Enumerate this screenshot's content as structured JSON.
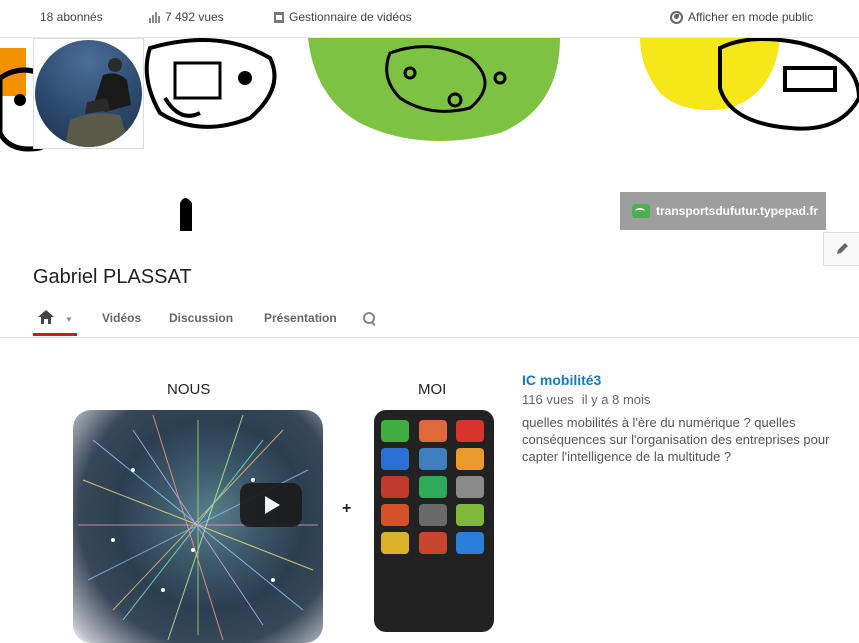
{
  "topbar": {
    "subscribers": "18 abonnés",
    "views": "7 492 vues",
    "video_manager": "Gestionnaire de vidéos",
    "public_view": "Afficher en mode public"
  },
  "banner": {
    "website_link": "transportsdufutur.typepad.fr"
  },
  "channel": {
    "title": "Gabriel PLASSAT"
  },
  "tabs": [
    {
      "label": "Vidéos"
    },
    {
      "label": "Discussion"
    },
    {
      "label": "Présentation"
    }
  ],
  "featured": {
    "thumb_left_label": "NOUS",
    "thumb_right_label": "MOI",
    "plus": "+",
    "title": "IC mobilité3",
    "views": "116 vues",
    "age": "il y a 8 mois",
    "description": "quelles mobilités à l'ère du numérique ? quelles conséquences sur l'organisation des entreprises pour capter l'intelligence de la multitude ?"
  },
  "colors": {
    "accent_red": "#cc181e",
    "link_blue": "#167ac6",
    "banner_green": "#7dc242",
    "banner_yellow": "#f7e61a",
    "banner_orange": "#f39200"
  },
  "icons": {
    "stats": "bar-chart-icon",
    "manager": "film-icon",
    "public": "globe-icon",
    "home": "home-icon",
    "search": "search-icon",
    "edit": "pencil-icon",
    "play": "play-icon"
  }
}
